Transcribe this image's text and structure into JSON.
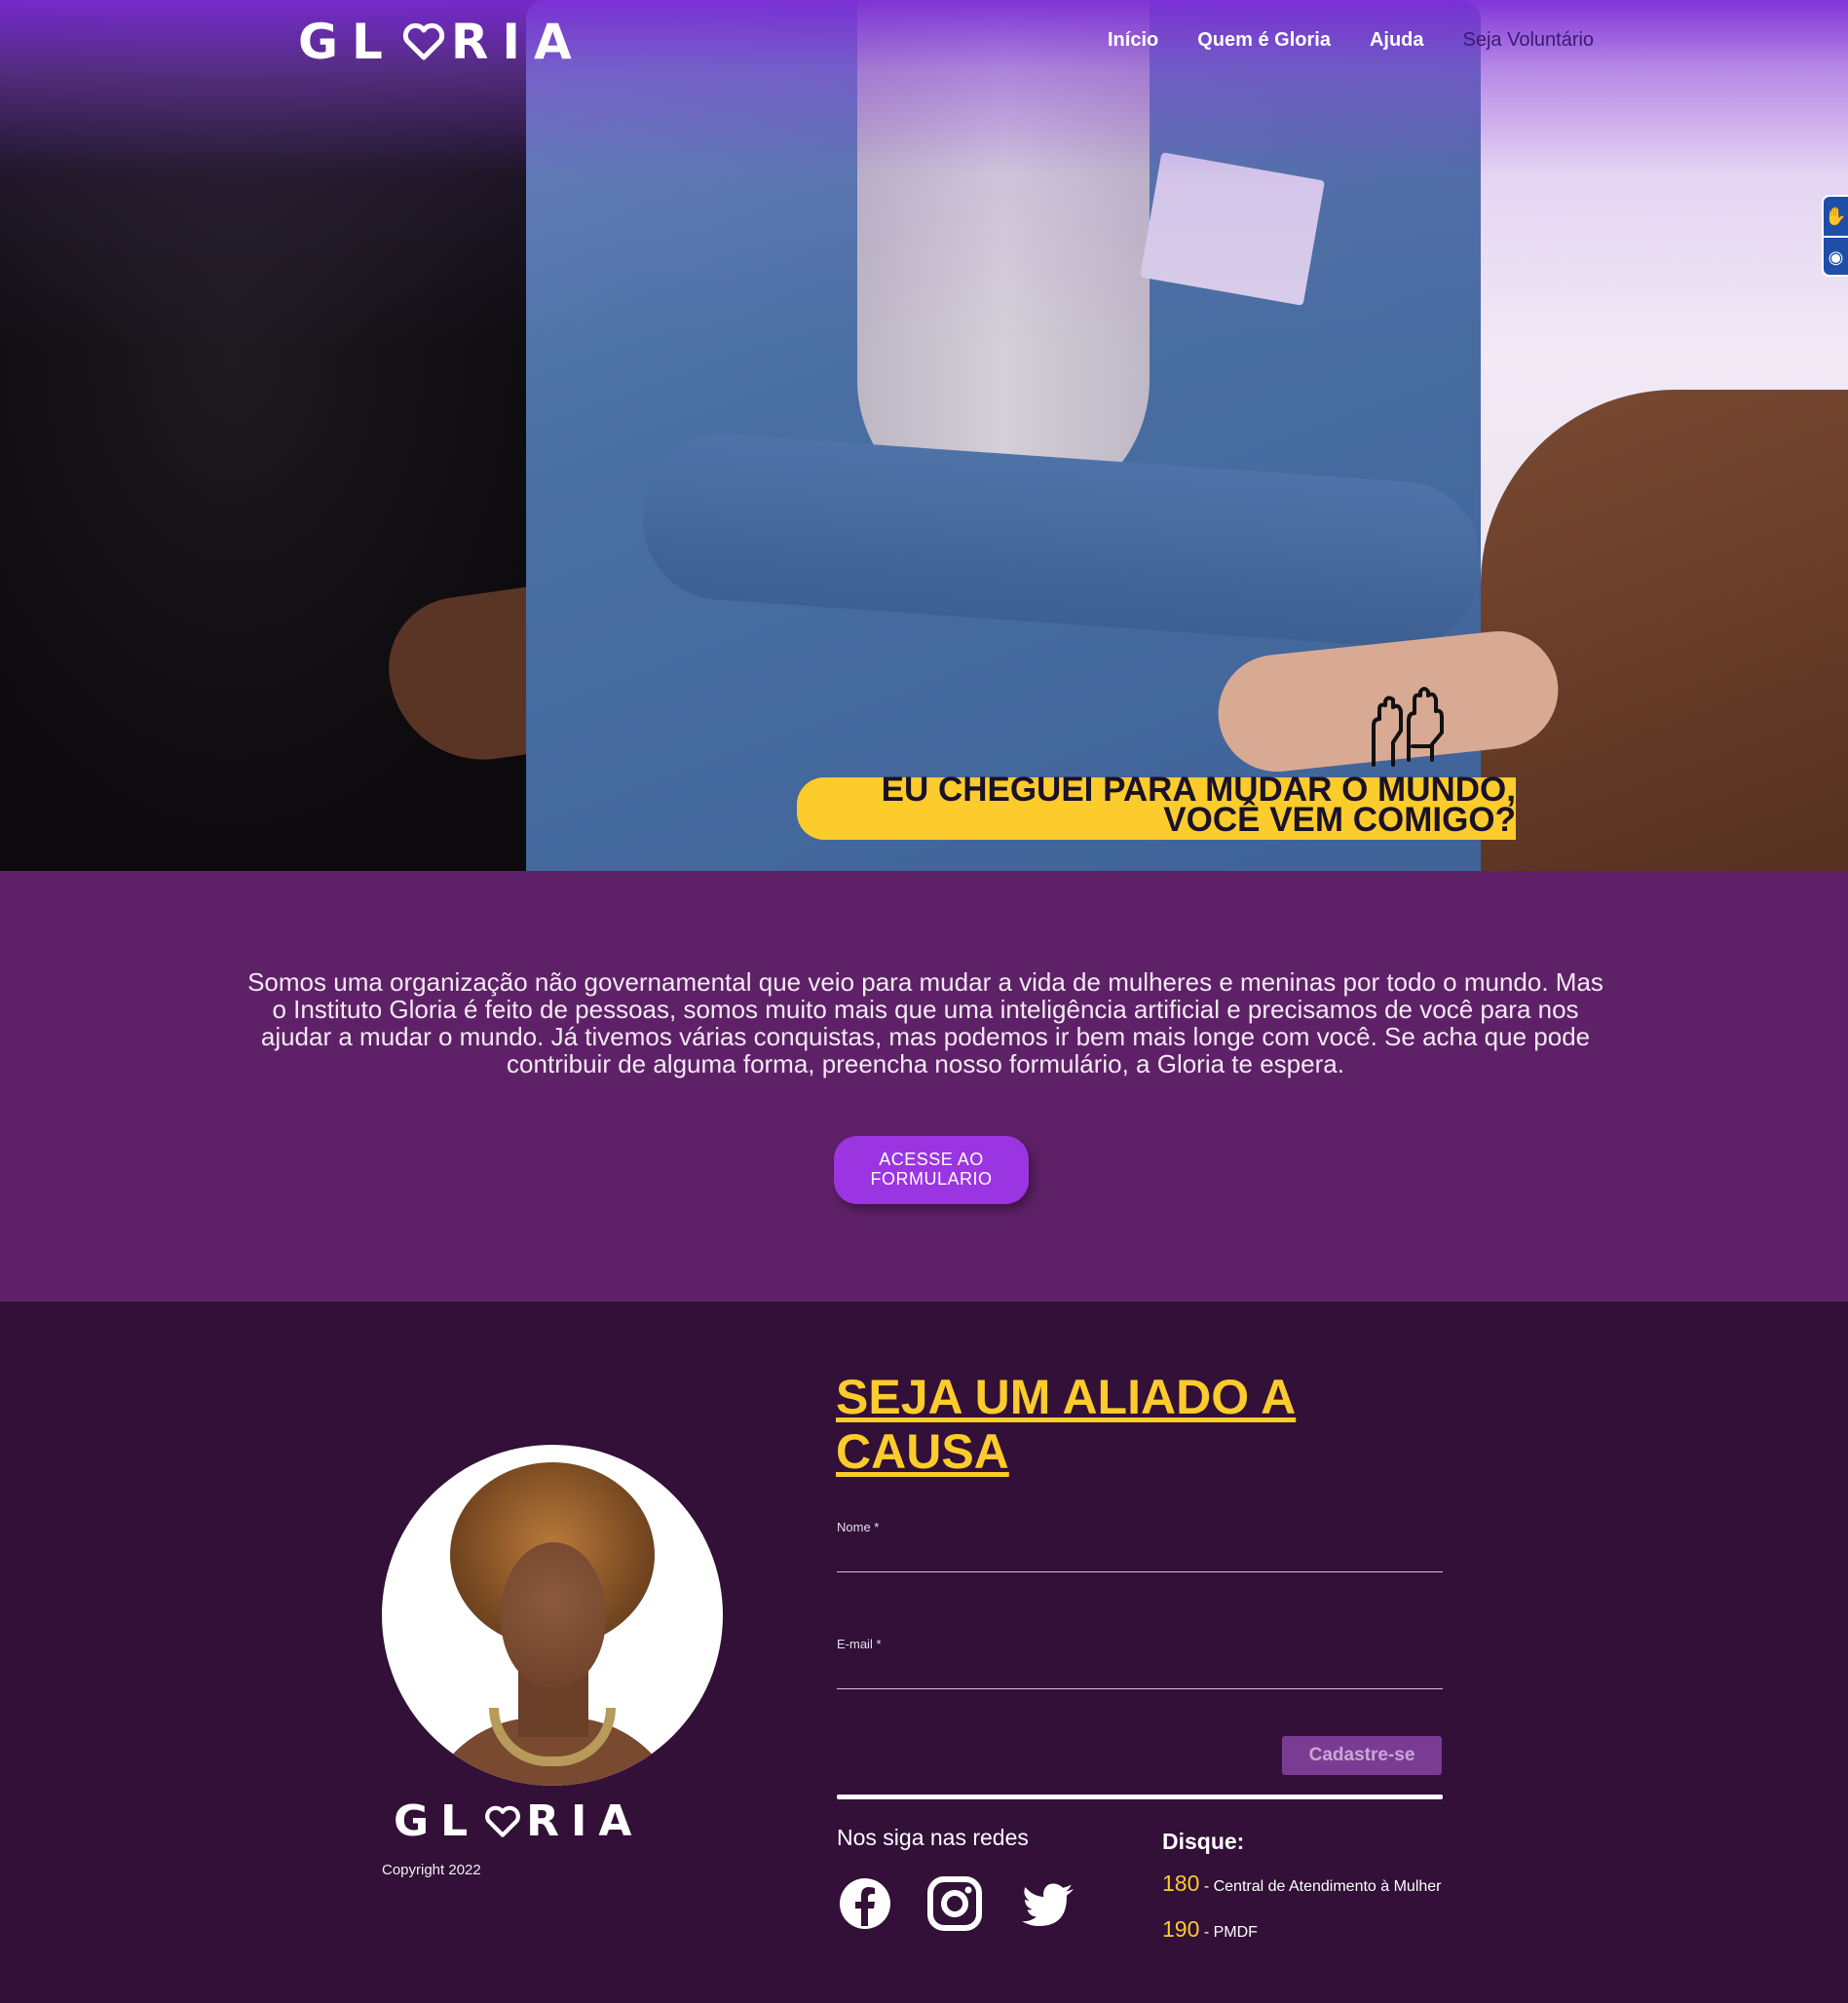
{
  "brand": {
    "logo_left": "GL",
    "logo_right": "RIA"
  },
  "nav": {
    "items": [
      {
        "label": "Início"
      },
      {
        "label": "Quem é Gloria"
      },
      {
        "label": "Ajuda"
      },
      {
        "label": "Seja Voluntário"
      }
    ]
  },
  "hero": {
    "banner_line1": "EU CHEGUEI PARA MUDAR O MUNDO,",
    "banner_line2": "VOCÊ VEM COMIGO?"
  },
  "mission": {
    "text": "Somos uma organização não governamental que veio para mudar a vida de mulheres e meninas por todo o mundo. Mas o Instituto Gloria é feito de pessoas, somos muito mais que uma inteligência artificial e precisamos de você para nos ajudar a mudar o mundo. Já tivemos várias conquistas, mas podemos ir bem mais longe com você. Se acha que pode contribuir de alguma forma, preencha nosso formulário, a Gloria te espera.",
    "cta_line1": "ACESSE AO",
    "cta_line2": "FORMULARIO"
  },
  "signup": {
    "title": "SEJA UM ALIADO A CAUSA",
    "name_label": "Nome *",
    "email_label": "E-mail *",
    "submit_label": "Cadastre-se"
  },
  "footer": {
    "copyright": "Copyright 2022",
    "social_title": "Nos siga nas redes",
    "social_icons": [
      "facebook-icon",
      "instagram-icon",
      "twitter-icon"
    ],
    "disque_title": "Disque:",
    "phones": [
      {
        "number": "180",
        "desc": " - Central de Atendimento à Mulher"
      },
      {
        "number": "190",
        "desc": " - PMDF"
      }
    ]
  },
  "colors": {
    "accent_yellow": "#fccb2c",
    "purple_section": "#5e2167",
    "dark_section": "#321038",
    "cta_purple": "#9b35e2"
  }
}
